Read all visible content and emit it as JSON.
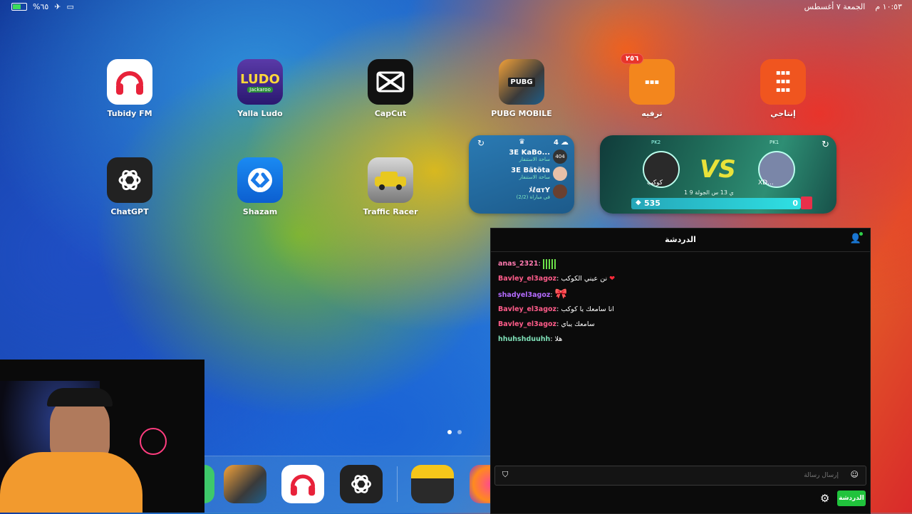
{
  "status": {
    "battery": "%٦٥",
    "time": "١٠:٥٣ م",
    "date": "الجمعة ٧ أغسطس"
  },
  "apps": [
    {
      "label": "Tubidy FM",
      "icon": "headphones-icon"
    },
    {
      "label": "Yalla Ludo",
      "icon": "ludo-icon",
      "icon_text": "LUDO",
      "icon_sub": "Jackaroo"
    },
    {
      "label": "CapCut",
      "icon": "capcut-icon"
    },
    {
      "label": "PUBG MOBILE",
      "icon": "pubg-icon",
      "icon_text": "PUBG"
    },
    {
      "label": "ترفيه",
      "icon": "folder-icon",
      "badge": "٢٥٦"
    },
    {
      "label": "إنتاجي",
      "icon": "folder-icon"
    },
    {
      "label": "ChatGPT",
      "icon": "chatgpt-icon"
    },
    {
      "label": "Shazam",
      "icon": "shazam-icon"
    },
    {
      "label": "Traffic Racer",
      "icon": "car-icon"
    }
  ],
  "widget_chat": {
    "count": "4",
    "rows": [
      {
        "name": "KaBo...",
        "prefix": "3E",
        "sub": "ساحة الاستنفار",
        "badge": "404"
      },
      {
        "name": "Bätöta",
        "prefix": "3E",
        "sub": "ساحة الاستنفار"
      },
      {
        "name": "ﾒℓαтY",
        "sub": "(2/2) في مباراة"
      }
    ]
  },
  "widget_vs": {
    "vs": "VS",
    "left_tag": "PK2",
    "right_tag": "PK1",
    "left_name": "كوكب",
    "right_name": "XD...",
    "round_info": "1 ي 13 س  الجولة 9",
    "score_left": "535",
    "score_right": "0"
  },
  "chat": {
    "title": "الدردشة",
    "input_placeholder": "إرسال رسالة",
    "send_label": "الدردشة",
    "messages": [
      {
        "user": "anas_2321",
        "text": "",
        "color": "#ff7ab0",
        "emote": "green-bars"
      },
      {
        "user": "Bavley_el3agoz",
        "text": "نن عيني الكوكب",
        "color": "#ff5c8a",
        "emote": "heart"
      },
      {
        "user": "shadyel3agoz",
        "text": "",
        "color": "#b46bff",
        "emote": "ribbon"
      },
      {
        "user": "Bavley_el3agoz",
        "text": "انا سامعك يا كوكب",
        "color": "#ff5c8a"
      },
      {
        "user": "Bavley_el3agoz",
        "text": "سامعك يباي",
        "color": "#ff5c8a"
      },
      {
        "user": "hhuhshduuhh",
        "text": "هلا",
        "color": "#7fe0b8"
      }
    ]
  },
  "dock": {
    "apps": [
      "PUBG MOBILE",
      "Tubidy FM",
      "ChatGPT",
      "Notes",
      "Photos"
    ]
  }
}
